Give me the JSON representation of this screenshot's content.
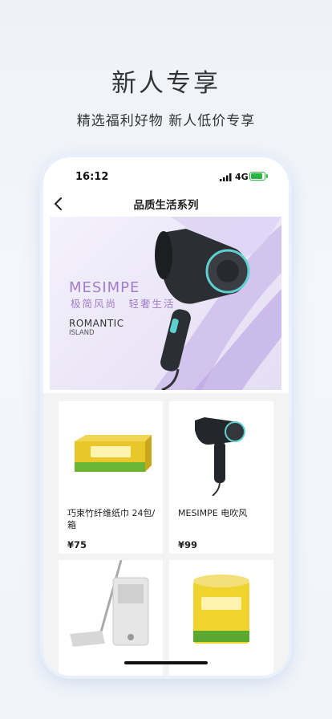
{
  "promo": {
    "headline": "新人专享",
    "subline": "精选福利好物 新人低价专享"
  },
  "status_bar": {
    "time": "16:12",
    "network": "4G",
    "battery_level": 1.0
  },
  "nav": {
    "title": "品质生活系列",
    "back_icon": "chevron-left-icon"
  },
  "banner": {
    "brand": "MESIMPE",
    "slogan": "极简风尚　轻奢生活",
    "tagline_1": "ROMANTIC",
    "tagline_2": "ISLAND"
  },
  "products": [
    {
      "name": "巧束竹纤维纸巾 24包/箱",
      "price": "¥75"
    },
    {
      "name": "MESIMPE 电吹风",
      "price": "¥99"
    },
    {
      "name": "",
      "price": ""
    },
    {
      "name": "",
      "price": ""
    }
  ],
  "colors": {
    "accent_purple": "#a27cc9",
    "battery_green": "#2ab543",
    "background": "#eef2f8"
  }
}
